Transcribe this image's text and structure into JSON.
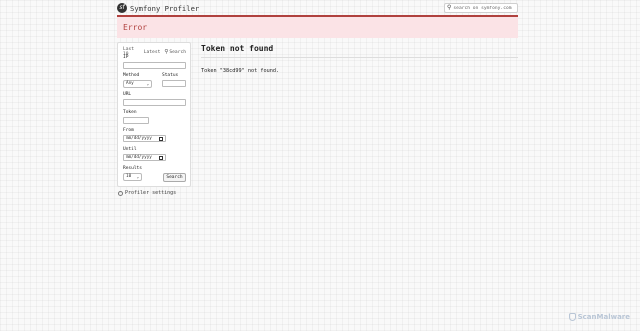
{
  "header": {
    "brand": "Symfony Profiler",
    "logo_glyph": "sf",
    "search_placeholder": "search on symfony.com"
  },
  "error_bar": {
    "title": "Error"
  },
  "sidebar": {
    "tabs": [
      "Last 10",
      "Latest"
    ],
    "search_tab": "Search",
    "ip_label": "IP",
    "method_label": "Method",
    "method_value": "Any",
    "status_label": "Status",
    "url_label": "URL",
    "token_label": "Token",
    "from_label": "From",
    "from_placeholder": "mm/dd/yyyy",
    "until_label": "Until",
    "until_placeholder": "mm/dd/yyyy",
    "results_label": "Results",
    "results_value": "10",
    "search_button": "Search"
  },
  "settings_link": "Profiler settings",
  "main": {
    "title": "Token not found",
    "message": "Token \"38cd99\" not found."
  },
  "watermark": "ScanMalware",
  "colors": {
    "accent": "#b0413e",
    "error_bg": "#fbe3e6"
  }
}
